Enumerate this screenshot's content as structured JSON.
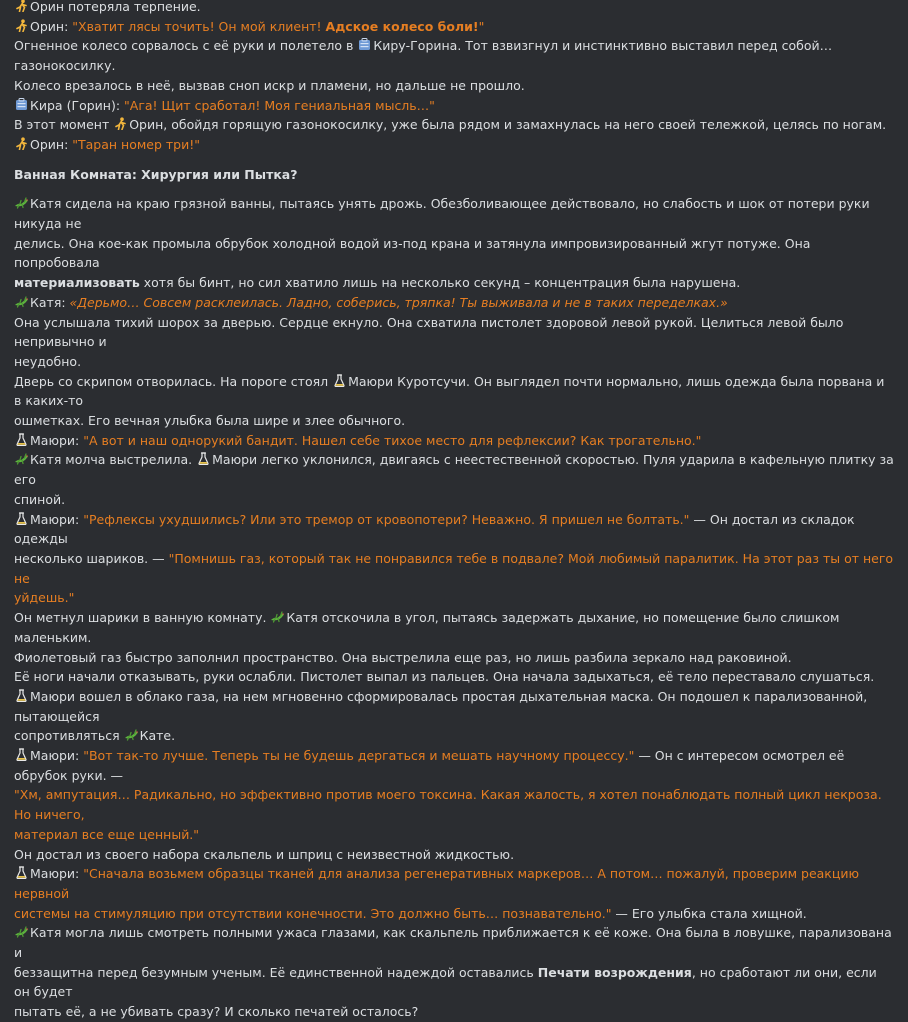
{
  "icons": {
    "orin": "walking-figure-icon",
    "kira": "bag-icon",
    "katya": "lizard-icon",
    "mauri": "flask-icon"
  },
  "colors": {
    "background": "#2b2d31",
    "text": "#dbdee1",
    "quote": "#e67e22"
  },
  "lines": {
    "l1": {
      "name": "Орин",
      "text": " потеряла терпение."
    },
    "l2": {
      "name": "Орин",
      "sep": ": ",
      "q1": "\"Хватит лясы точить! Он мой клиент! ",
      "qb": "Адское колесо боли!",
      "q2": "\""
    },
    "l3": {
      "t1": "Огненное колесо сорвалось с её руки и полетело в ",
      "t2": "Киру-Горина. Тот взвизгнул и инстинктивно выставил перед собой… газонокосилку."
    },
    "l4": {
      "t1": "Колесо врезалось в неё, вызвав сноп искр и пламени, но дальше не прошло."
    },
    "l5": {
      "name": "Кира (Горин)",
      "sep": ": ",
      "q": "\"Ага! Щит сработал! Моя гениальная мысль…\""
    },
    "l6": {
      "t1": "В этот момент ",
      "t2": "Орин, обойдя горящую газонокосилку, уже была рядом и замахнулась на него своей тележкой, целясь по ногам."
    },
    "l7": {
      "name": "Орин",
      "sep": ": ",
      "q": "\"Таран номер три!\""
    },
    "heading": "Ванная Комната: Хирургия или Пытка?",
    "l8": {
      "t1": "Катя сидела на краю грязной ванны, пытаясь унять дрожь. Обезболивающее действовало, но слабость и шок от потери руки никуда не"
    },
    "l9": {
      "t1": "делись. Она кое-как промыла обрубок холодной водой из-под крана и затянула импровизированный жгут потуже. Она попробовала"
    },
    "l10": {
      "b": "материализовать",
      "t1": " хотя бы бинт, но сил хватило лишь на несколько секунд – концентрация была нарушена."
    },
    "l11": {
      "name": "Катя",
      "sep": ": ",
      "q": "«Дерьмо… Совсем расклеилась. Ладно, соберись, тряпка! Ты выживала и не в таких переделках.»"
    },
    "l12": {
      "t1": "Она услышала тихий шорох за дверью. Сердце екнуло. Она схватила пистолет здоровой левой рукой. Целиться левой было непривычно и"
    },
    "l13": {
      "t1": "неудобно."
    },
    "l14": {
      "t1": "Дверь со скрипом отворилась. На пороге стоял ",
      "t2": "Маюри Куротсучи. Он выглядел почти нормально, лишь одежда была порвана и в каких-то"
    },
    "l15": {
      "t1": "ошметках. Его вечная улыбка была шире и злее обычного."
    },
    "l16": {
      "name": "Маюри",
      "sep": ": ",
      "q": "\"А вот и наш однорукий бандит. Нашел себе тихое место для рефлексии? Как трогательно.\""
    },
    "l17": {
      "t1": "Катя молча выстрелила. ",
      "t2": "Маюри легко уклонился, двигаясь с неестественной скоростью. Пуля ударила в кафельную плитку за его"
    },
    "l18": {
      "t1": "спиной."
    },
    "l19": {
      "name": "Маюри",
      "sep": ": ",
      "q": "\"Рефлексы ухудшились? Или это тремор от кровопотери? Неважно. Я пришел не болтать.\"",
      "t1": " — Он достал из складок одежды"
    },
    "l20": {
      "t1": "несколько шариков. — ",
      "q": "\"Помнишь газ, который так не понравился тебе в подвале? Мой любимый паралитик. На этот раз ты от него не"
    },
    "l21": {
      "q": "уйдешь.\""
    },
    "l22": {
      "t1": "Он метнул шарики в ванную комнату. ",
      "t2": "Катя отскочила в угол, пытаясь задержать дыхание, но помещение было слишком маленьким."
    },
    "l23": {
      "t1": "Фиолетовый газ быстро заполнил пространство. Она выстрелила еще раз, но лишь разбила зеркало над раковиной."
    },
    "l24": {
      "t1": "Её ноги начали отказывать, руки ослабли. Пистолет выпал из пальцев. Она начала задыхаться, её тело переставало слушаться."
    },
    "l25": {
      "t1": "Маюри вошел в облако газа, на нем мгновенно сформировалась простая дыхательная маска. Он подошел к парализованной, пытающейся"
    },
    "l26": {
      "t1": "сопротивляться ",
      "t2": "Кате."
    },
    "l27": {
      "name": "Маюри",
      "sep": ": ",
      "q": "\"Вот так-то лучше. Теперь ты не будешь дергаться и мешать научному процессу.\"",
      "t1": " — Он с интересом осмотрел её обрубок руки. —"
    },
    "l28": {
      "q": "\"Хм, ампутация… Радикально, но эффективно против моего токсина. Какая жалость, я хотел понаблюдать полный цикл некроза. Но ничего,"
    },
    "l29": {
      "q": "материал все еще ценный.\""
    },
    "l30": {
      "t1": "Он достал из своего набора скальпель и шприц с неизвестной жидкостью."
    },
    "l31": {
      "name": "Маюри",
      "sep": ": ",
      "q": "\"Сначала возьмем образцы тканей для анализа регенеративных маркеров… А потом… пожалуй, проверим реакцию нервной"
    },
    "l32": {
      "q": "системы на стимуляцию при отсутствии конечности. Это должно быть… познавательно.\"",
      "t1": " — Его улыбка стала хищной."
    },
    "l33": {
      "t1": "Катя могла лишь смотреть полными ужаса глазами, как скальпель приближается к её коже. Она была в ловушке, парализована и"
    },
    "l34": {
      "t1": "беззащитна перед безумным ученым. Её единственной надеждой оставались ",
      "b": "Печати возрождения",
      "t2": ", но сработают ли они, если он будет"
    },
    "l35": {
      "t1": "пытать её, а не убивать сразу? И сколько печатей осталось?"
    }
  }
}
